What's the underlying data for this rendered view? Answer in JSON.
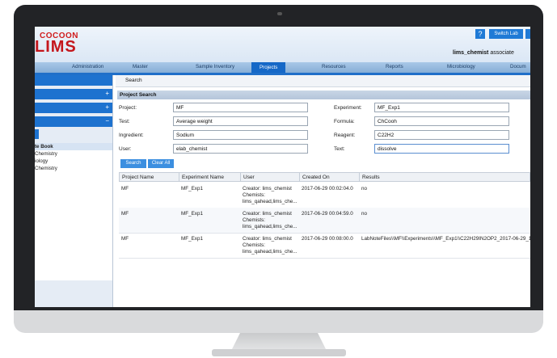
{
  "app": {
    "logo_top": "COCOON",
    "logo_main": "LIMS",
    "help_label": "?",
    "switch_lab_label": "Switch Lab",
    "user_name": "lims_chemist",
    "user_suffix": "associate"
  },
  "nav": {
    "items": [
      "Administration",
      "Master",
      "Sample Inventory",
      "Projects",
      "Resources",
      "Reports",
      "Microbiology",
      "Docum"
    ],
    "active": "Projects"
  },
  "sidebar": {
    "expand_1": "+",
    "expand_2": "+",
    "collapse": "−",
    "tree_title": "te Book",
    "tree_items": [
      "Chemistry",
      "iology",
      "Chemistry"
    ]
  },
  "main": {
    "subtab": "Search",
    "section_title": "Project Search",
    "fields": {
      "project_label": "Project:",
      "project_value": "MF",
      "test_label": "Test:",
      "test_value": "Average weight",
      "ingredient_label": "Ingredient:",
      "ingredient_value": "Sodium",
      "user_label": "User:",
      "user_value": "elab_chemist",
      "experiment_label": "Experiment:",
      "experiment_value": "MF_Exp1",
      "formula_label": "Formula:",
      "formula_value": "ChCooh",
      "reagent_label": "Reagent:",
      "reagent_value": "C22H2",
      "text_label": "Text:",
      "text_value": "dissolve"
    },
    "search_button": "Search",
    "clear_button": "Clear All"
  },
  "results": {
    "columns": [
      "Project Name",
      "Experiment Name",
      "User",
      "Created On",
      "Results"
    ],
    "rows": [
      {
        "project": "MF",
        "experiment": "MF_Exp1",
        "user_1": "Creator: lims_chemist",
        "user_2": "Chemists:",
        "user_3": "lims_qahead,lims_che...",
        "created": "2017-06-29 00:02:04.0",
        "result": "no"
      },
      {
        "project": "MF",
        "experiment": "MF_Exp1",
        "user_1": "Creator: lims_chemist",
        "user_2": "Chemists:",
        "user_3": "lims_qahead,lims_che...",
        "created": "2017-06-29 00:04:59.0",
        "result": "no"
      },
      {
        "project": "MF",
        "experiment": "MF_Exp1",
        "user_1": "Creator: lims_chemist",
        "user_2": "Chemists:",
        "user_3": "lims_qahead,lims_che...",
        "created": "2017-06-29 00:08:00.0",
        "result": "LabNoteFiles\\\\MF\\\\Experiments\\\\MF_Exp1\\\\C22H29IN2OP2_2017-06-29_1"
      }
    ]
  },
  "colors": {
    "accent": "#1f6fc9",
    "nav_bg": "#9ebfe2",
    "logo_red": "#c4161c",
    "bezel": "#222326"
  }
}
